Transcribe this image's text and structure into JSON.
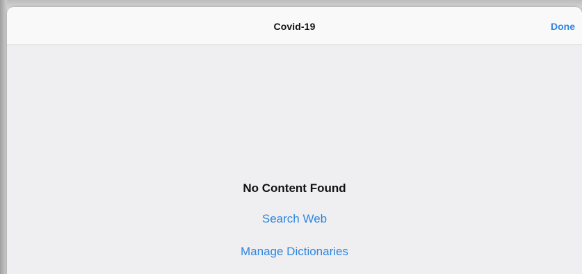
{
  "nav": {
    "title": "Covid-19",
    "done_label": "Done"
  },
  "content": {
    "empty_message": "No Content Found",
    "search_web_label": "Search Web",
    "manage_dictionaries_label": "Manage Dictionaries"
  },
  "colors": {
    "accent": "#2f86e0",
    "sheet_background": "#efeff1",
    "navbar_background": "#f9f9f9"
  }
}
